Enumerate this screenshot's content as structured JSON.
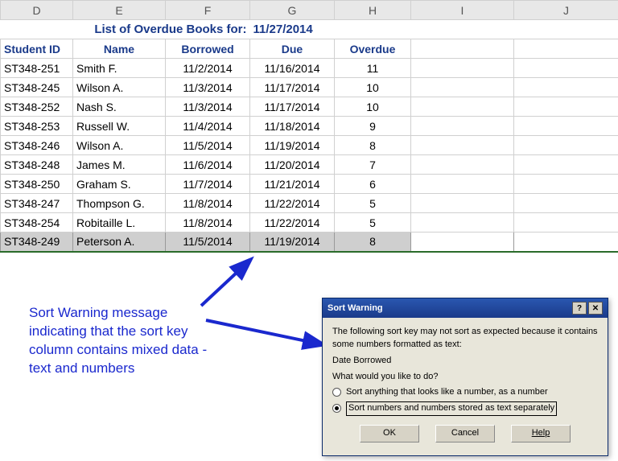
{
  "columns": [
    "D",
    "E",
    "F",
    "G",
    "H",
    "I",
    "J"
  ],
  "title_left": "List of Overdue Books for:",
  "title_date": "11/27/2014",
  "headers": {
    "student_id": "Student ID",
    "name": "Name",
    "borrowed": "Borrowed",
    "due": "Due",
    "overdue": "Overdue"
  },
  "rows": [
    {
      "id": "ST348-251",
      "name": "Smith F.",
      "borrowed": "11/2/2014",
      "due": "11/16/2014",
      "overdue": "11"
    },
    {
      "id": "ST348-245",
      "name": "Wilson A.",
      "borrowed": "11/3/2014",
      "due": "11/17/2014",
      "overdue": "10"
    },
    {
      "id": "ST348-252",
      "name": "Nash S.",
      "borrowed": "11/3/2014",
      "due": "11/17/2014",
      "overdue": "10"
    },
    {
      "id": "ST348-253",
      "name": "Russell W.",
      "borrowed": "11/4/2014",
      "due": "11/18/2014",
      "overdue": "9"
    },
    {
      "id": "ST348-246",
      "name": "Wilson A.",
      "borrowed": "11/5/2014",
      "due": "11/19/2014",
      "overdue": "8"
    },
    {
      "id": "ST348-248",
      "name": "James M.",
      "borrowed": "11/6/2014",
      "due": "11/20/2014",
      "overdue": "7"
    },
    {
      "id": "ST348-250",
      "name": "Graham S.",
      "borrowed": "11/7/2014",
      "due": "11/21/2014",
      "overdue": "6"
    },
    {
      "id": "ST348-247",
      "name": "Thompson G.",
      "borrowed": "11/8/2014",
      "due": "11/22/2014",
      "overdue": "5"
    },
    {
      "id": "ST348-254",
      "name": "Robitaille L.",
      "borrowed": "11/8/2014",
      "due": "11/22/2014",
      "overdue": "5"
    },
    {
      "id": "ST348-249",
      "name": "Peterson A.",
      "borrowed": "11/5/2014",
      "due": "11/19/2014",
      "overdue": "8"
    }
  ],
  "annotation": "Sort Warning message indicating that the sort key column contains mixed data - text and numbers",
  "dialog": {
    "title": "Sort Warning",
    "msg": "The following sort key may not sort as expected because it contains some numbers formatted as text:",
    "field": "Date Borrowed",
    "prompt": "What would you like to do?",
    "opt1": "Sort anything that looks like a number, as a number",
    "opt2": "Sort numbers and numbers stored as text separately",
    "ok": "OK",
    "cancel": "Cancel",
    "help": "Help"
  }
}
